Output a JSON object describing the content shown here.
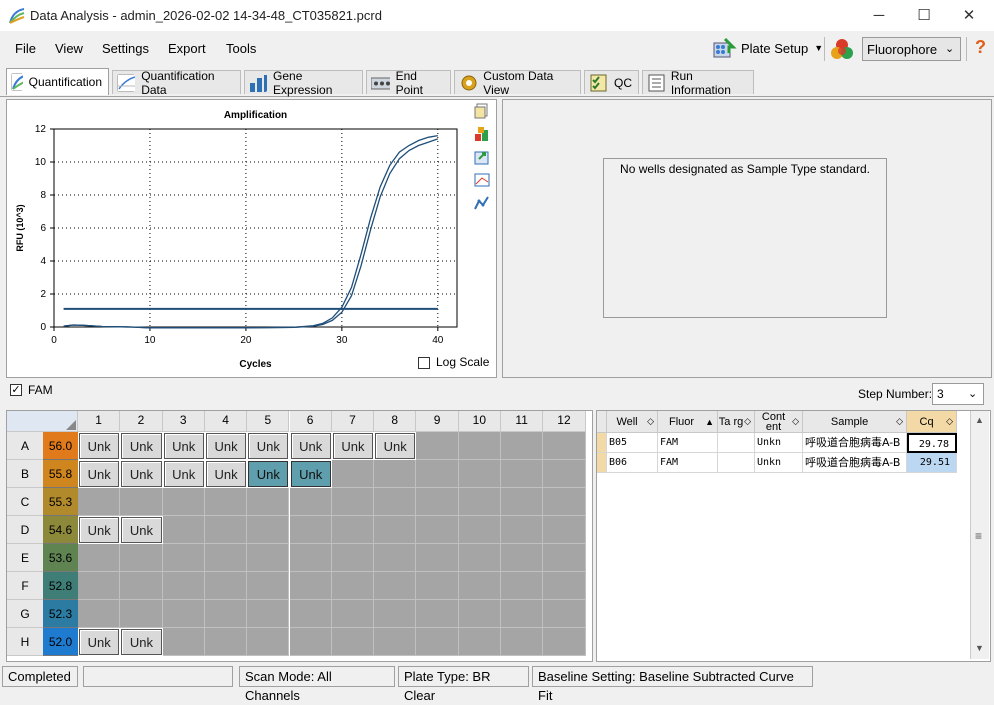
{
  "window": {
    "title": "Data Analysis - admin_2026-02-02 14-34-48_CT035821.pcrd",
    "minimize": "─",
    "maximize": "☐",
    "close": "✕"
  },
  "menu": [
    "File",
    "View",
    "Settings",
    "Export",
    "Tools"
  ],
  "toolbar": {
    "plate_setup": "Plate Setup",
    "fluorophore": "Fluorophore",
    "help": "?"
  },
  "tabs": [
    {
      "label": "Quantification",
      "icon": "amplification-curve-icon",
      "active": true
    },
    {
      "label": "Quantification Data",
      "icon": "data-chart-icon"
    },
    {
      "label": "Gene Expression",
      "icon": "bar-chart-icon"
    },
    {
      "label": "End Point",
      "icon": "endpoint-icon"
    },
    {
      "label": "Custom Data View",
      "icon": "gear-icon"
    },
    {
      "label": "QC",
      "icon": "checklist-icon"
    },
    {
      "label": "Run Information",
      "icon": "document-icon"
    }
  ],
  "chart_data": {
    "type": "line",
    "title": "Amplification",
    "xlabel": "Cycles",
    "ylabel": "RFU (10^3)",
    "xlim": [
      0,
      42
    ],
    "ylim": [
      0,
      12
    ],
    "xticks": [
      0,
      10,
      20,
      30,
      40
    ],
    "yticks": [
      0,
      2,
      4,
      6,
      8,
      10,
      12
    ],
    "grid": true,
    "threshold": 1.1,
    "series": [
      {
        "well": "B05",
        "color": "#1f4e79",
        "x": [
          1,
          2,
          3,
          5,
          8,
          10,
          12,
          15,
          20,
          25,
          27,
          28,
          29,
          30,
          31,
          32,
          33,
          34,
          35,
          36,
          37,
          38,
          39,
          40
        ],
        "y": [
          0.05,
          0.12,
          0.1,
          0.03,
          0,
          -0.05,
          -0.05,
          -0.05,
          -0.05,
          -0.02,
          0.05,
          0.15,
          0.4,
          0.9,
          1.9,
          3.7,
          5.9,
          7.9,
          9.3,
          10.2,
          10.7,
          11.0,
          11.2,
          11.4
        ]
      },
      {
        "well": "B06",
        "color": "#1f4e79",
        "x": [
          1,
          2,
          3,
          5,
          8,
          10,
          12,
          15,
          20,
          25,
          27,
          28,
          29,
          30,
          31,
          32,
          33,
          34,
          35,
          36,
          37,
          38,
          39,
          40
        ],
        "y": [
          0.05,
          0.12,
          0.1,
          0.03,
          0,
          -0.05,
          -0.05,
          -0.05,
          -0.05,
          -0.02,
          0.07,
          0.22,
          0.55,
          1.2,
          2.4,
          4.4,
          6.6,
          8.5,
          9.8,
          10.6,
          11.0,
          11.3,
          11.5,
          11.6
        ]
      }
    ]
  },
  "chart_panel": {
    "log_scale_label": "Log Scale",
    "log_scale_checked": false
  },
  "standard_panel": {
    "message": "No wells designated as Sample Type standard."
  },
  "fam": {
    "label": "FAM",
    "checked": true
  },
  "step": {
    "label": "Step Number:",
    "value": "3"
  },
  "plate": {
    "columns": [
      "1",
      "2",
      "3",
      "4",
      "5",
      "6",
      "7",
      "8",
      "9",
      "10",
      "11",
      "12"
    ],
    "rows": [
      {
        "label": "A",
        "temp": "56.0",
        "color": "#e07a1a",
        "wells": [
          "Unk",
          "Unk",
          "Unk",
          "Unk",
          "Unk",
          "Unk",
          "Unk",
          "Unk",
          "",
          "",
          "",
          ""
        ],
        "selected": []
      },
      {
        "label": "B",
        "temp": "55.8",
        "color": "#cf861f",
        "wells": [
          "Unk",
          "Unk",
          "Unk",
          "Unk",
          "Unk",
          "Unk",
          "",
          "",
          "",
          "",
          "",
          ""
        ],
        "selected": [
          4,
          5
        ]
      },
      {
        "label": "C",
        "temp": "55.3",
        "color": "#b18a2c",
        "wells": [
          "",
          "",
          "",
          "",
          "",
          "",
          "",
          "",
          "",
          "",
          "",
          ""
        ],
        "selected": []
      },
      {
        "label": "D",
        "temp": "54.6",
        "color": "#8c8a3a",
        "wells": [
          "Unk",
          "Unk",
          "",
          "",
          "",
          "",
          "",
          "",
          "",
          "",
          "",
          ""
        ],
        "selected": []
      },
      {
        "label": "E",
        "temp": "53.6",
        "color": "#5f8452",
        "wells": [
          "",
          "",
          "",
          "",
          "",
          "",
          "",
          "",
          "",
          "",
          "",
          ""
        ],
        "selected": []
      },
      {
        "label": "F",
        "temp": "52.8",
        "color": "#3f7d77",
        "wells": [
          "",
          "",
          "",
          "",
          "",
          "",
          "",
          "",
          "",
          "",
          "",
          ""
        ],
        "selected": []
      },
      {
        "label": "G",
        "temp": "52.3",
        "color": "#2b7ba2",
        "wells": [
          "",
          "",
          "",
          "",
          "",
          "",
          "",
          "",
          "",
          "",
          "",
          ""
        ],
        "selected": []
      },
      {
        "label": "H",
        "temp": "52.0",
        "color": "#1f7bd0",
        "wells": [
          "Unk",
          "Unk",
          "",
          "",
          "",
          "",
          "",
          "",
          "",
          "",
          "",
          ""
        ],
        "selected": []
      }
    ]
  },
  "table": {
    "headers": [
      "Well",
      "Fluor",
      "Ta rg",
      "Cont ent",
      "Sample",
      "Cq"
    ],
    "rows": [
      [
        "B05",
        "FAM",
        "",
        "Unkn",
        "呼吸道合胞病毒A-B",
        "29.78"
      ],
      [
        "B06",
        "FAM",
        "",
        "Unkn",
        "呼吸道合胞病毒A-B",
        "29.51"
      ]
    ]
  },
  "status": {
    "state": "Completed",
    "scan_mode": "Scan Mode: All Channels",
    "plate_type": "Plate Type: BR Clear",
    "baseline": "Baseline Setting: Baseline Subtracted Curve Fit"
  }
}
